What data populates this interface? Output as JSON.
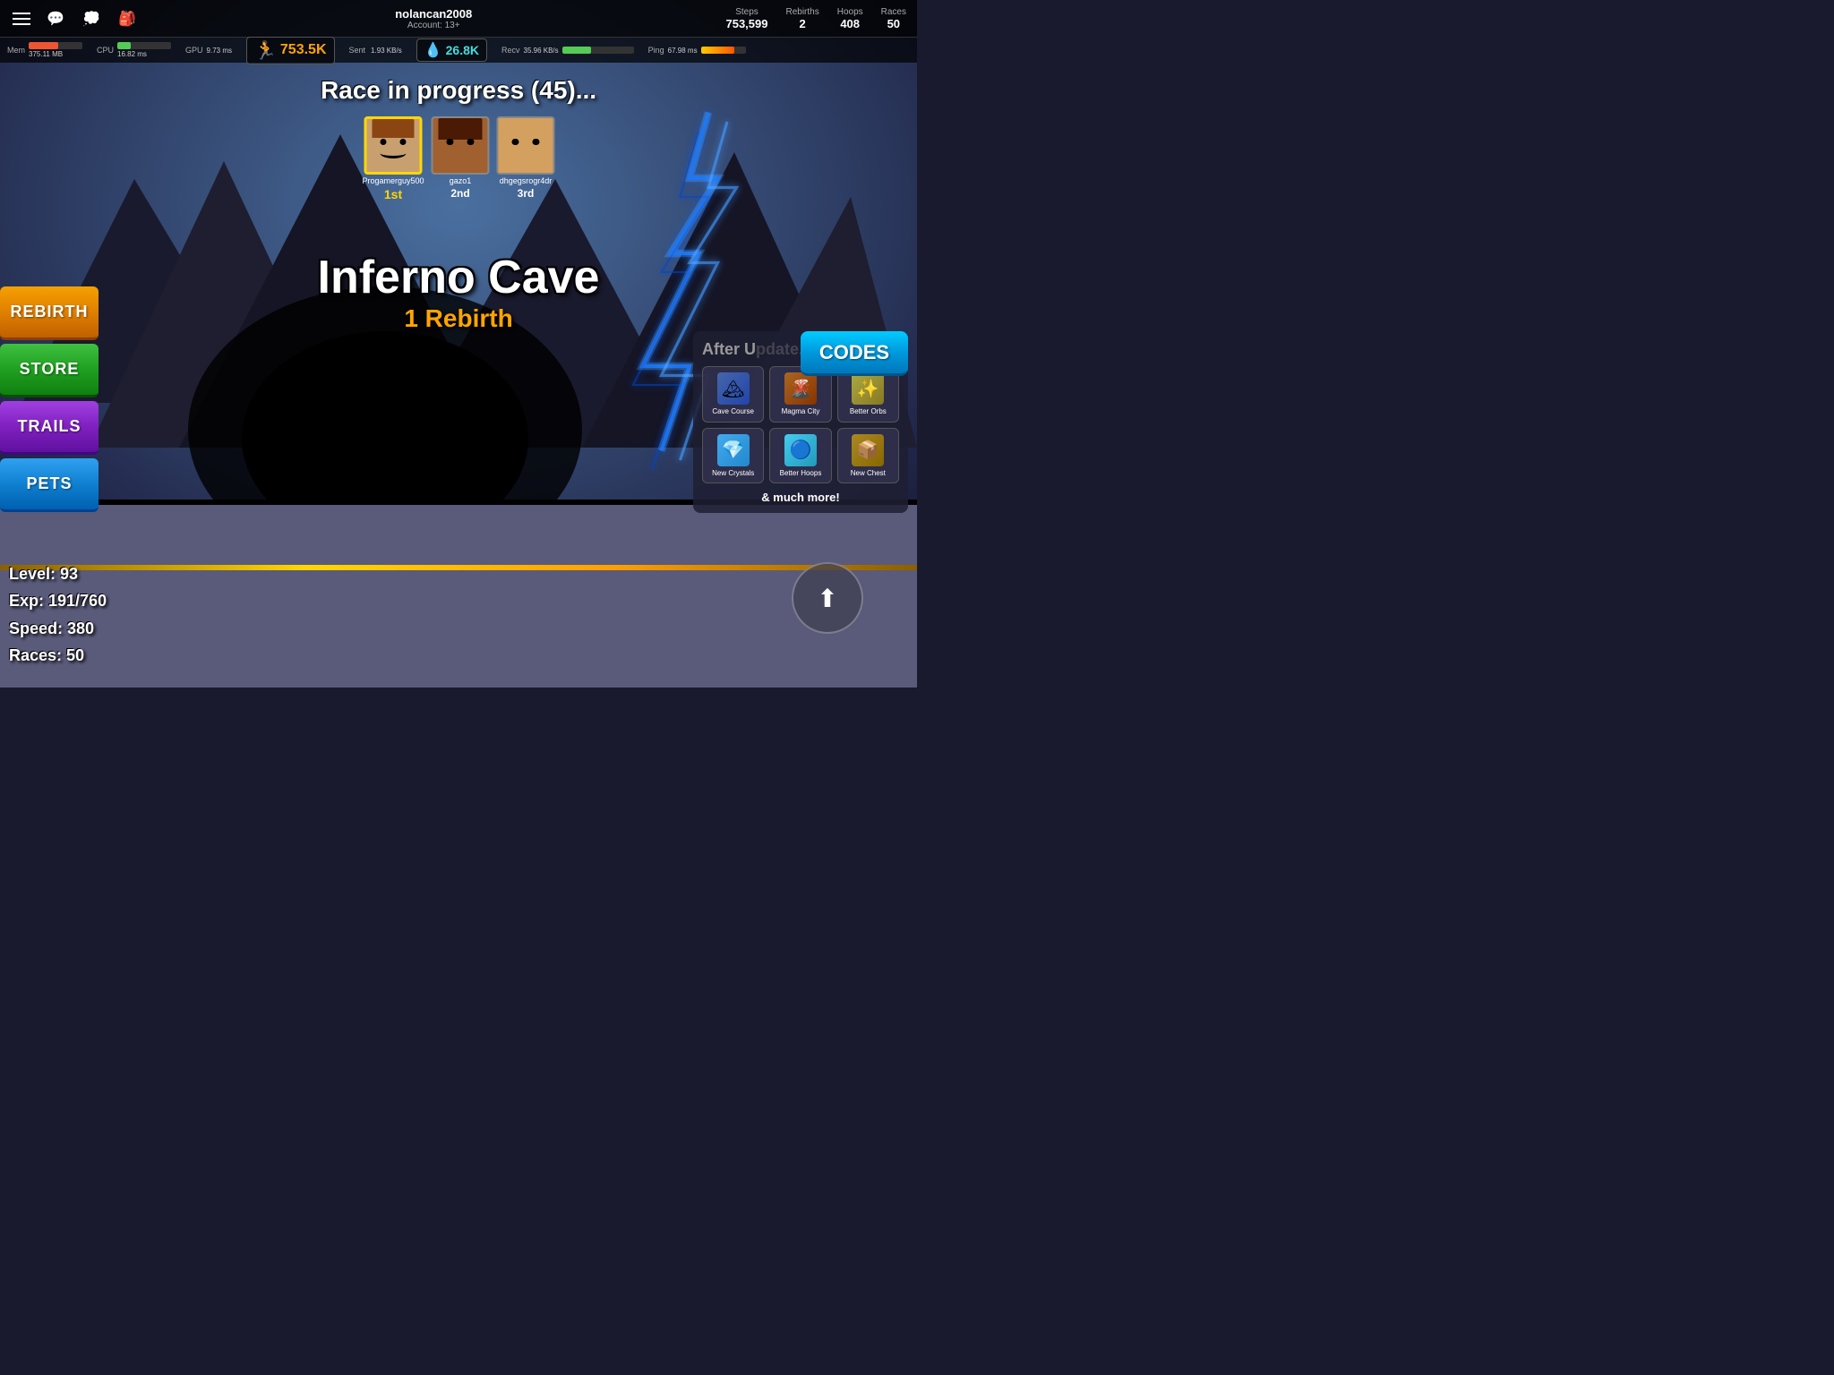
{
  "topbar": {
    "player_name": "nolancan2008",
    "account": "Account: 13+",
    "steps_label": "Steps",
    "steps_value": "753,599",
    "rebirths_label": "Rebirths",
    "rebirths_value": "2",
    "hoops_label": "Hoops",
    "hoops_value": "408",
    "races_label": "Races",
    "races_value": "50"
  },
  "perf": {
    "mem_label": "Mem",
    "mem_value": "375.11 MB",
    "cpu_label": "CPU",
    "cpu_value": "16.82 ms",
    "gpu_label": "GPU",
    "gpu_value": "9.73 ms",
    "gpu_display": "753.5K",
    "sent_label": "Sent",
    "sent_kb": "1.93 KB/s",
    "sent_display": "26.8K",
    "recv_label": "Recv",
    "recv_value": "35.96 KB/s",
    "ping_label": "Ping",
    "ping_value": "67.98 ms"
  },
  "race": {
    "status": "Race in progress (45)...",
    "positions": [
      {
        "rank": "1st",
        "username": "Progamerguy500",
        "place": 1
      },
      {
        "rank": "2nd",
        "username": "gazo1",
        "place": 2
      },
      {
        "rank": "3rd",
        "username": "dhgegsrogr4dr",
        "place": 3
      }
    ]
  },
  "zone": {
    "name": "Inferno Cave",
    "requirement": "1 Rebirth"
  },
  "buttons": {
    "rebirth": "REBIRTH",
    "store": "STORE",
    "trails": "TRAILS",
    "pets": "PETS",
    "codes": "CODES"
  },
  "player_stats": {
    "level": "Level: 93",
    "exp": "Exp: 191/760",
    "speed": "Speed: 380",
    "races": "Races: 50"
  },
  "right_panel": {
    "after_label": "After U",
    "items": [
      {
        "name": "Cave Course",
        "icon": "🏔"
      },
      {
        "name": "Magma City",
        "icon": "🌋"
      },
      {
        "name": "Better Orbs",
        "icon": "✨"
      },
      {
        "name": "New Crystals",
        "icon": "💎"
      },
      {
        "name": "Better Hoops",
        "icon": "🔵"
      },
      {
        "name": "New Chest",
        "icon": "📦"
      }
    ],
    "much_more": "& much more!"
  }
}
